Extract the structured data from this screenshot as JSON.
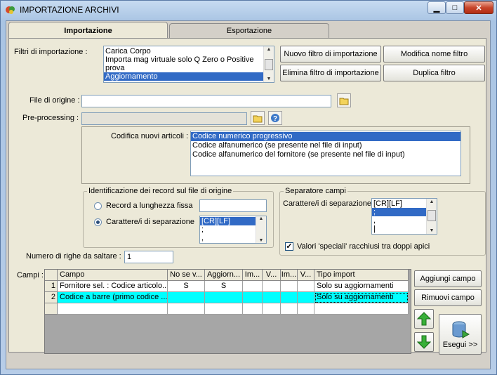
{
  "window": {
    "title": "IMPORTAZIONE ARCHIVI"
  },
  "tabs": [
    {
      "label": "Importazione",
      "active": true
    },
    {
      "label": "Esportazione",
      "active": false
    }
  ],
  "filters": {
    "label": "Filtri di importazione :",
    "items": [
      "Carica Corpo",
      "Importa mag virtuale solo Q Zero o Positive",
      "prova",
      "Aggiornamento"
    ],
    "selected_index": 3,
    "buttons": {
      "new": "Nuovo filtro di importazione",
      "rename": "Modifica nome filtro",
      "delete": "Elimina filtro di importazione",
      "duplicate": "Duplica filtro"
    }
  },
  "source_file": {
    "label": "File di origine :",
    "value": ""
  },
  "preprocessing": {
    "label": "Pre-processing :",
    "value": ""
  },
  "encoding": {
    "label": "Codifica nuovi articoli :",
    "items": [
      "Codice numerico progressivo",
      "Codice alfanumerico (se presente nel file di input)",
      "Codice alfanumerico del fornitore (se presente nel file di input)"
    ],
    "selected_index": 0
  },
  "record_id": {
    "legend": "Identificazione dei record sul file di origine",
    "fixed_length_label": "Record a lunghezza fissa",
    "separator_label": "Carattere/i di separazione",
    "selected": "separator",
    "separator_list": [
      "[CR][LF]",
      ";",
      ","
    ]
  },
  "field_separator": {
    "legend": "Separatore campi",
    "label": "Carattere/i di separazione",
    "list": [
      "[CR][LF]",
      ";",
      ",",
      "|"
    ],
    "selected_index": 1,
    "quoted_label": "Valori 'speciali' racchiusi tra doppi apici",
    "quoted_checked": true
  },
  "skip_rows": {
    "label": "Numero di righe da saltare :",
    "value": "1"
  },
  "fields": {
    "label": "Campi :",
    "columns": [
      "Campo",
      "No se v...",
      "Aggiorn...",
      "Im...",
      "V...",
      "Im...",
      "V...",
      "Tipo import"
    ],
    "rows": [
      {
        "n": "1",
        "cells": [
          "Fornitore sel. : Codice articolo...",
          "S",
          "S",
          "",
          "",
          "",
          "",
          "Solo su aggiornamenti"
        ]
      },
      {
        "n": "2",
        "cells": [
          "Codice a barre (primo codice ...",
          "",
          "",
          "",
          "",
          "",
          "",
          "Solo su aggiornamenti"
        ]
      }
    ],
    "selected_row": 1
  },
  "side_buttons": {
    "add": "Aggiungi campo",
    "remove": "Rimuovi campo",
    "run": "Esegui >>"
  },
  "colors": {
    "selection": "#316ac5",
    "grid_selected_row": "#00ffff",
    "panel": "#ece9d8"
  }
}
